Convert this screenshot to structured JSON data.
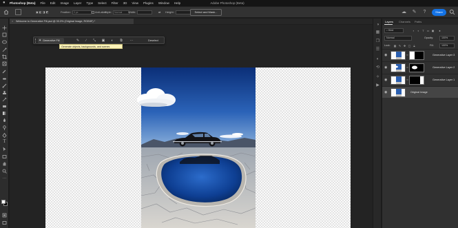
{
  "menubar": {
    "items": [
      "Photoshop (Beta)",
      "File",
      "Edit",
      "Image",
      "Layer",
      "Type",
      "Select",
      "Filter",
      "3D",
      "View",
      "Plugins",
      "Window",
      "Help"
    ],
    "title": "Adobe Photoshop (Beta)"
  },
  "options": {
    "feather_label": "Feather:",
    "feather_value": "0 px",
    "style_label": "Style:",
    "style_value": "Normal",
    "width_label": "Width:",
    "height_label": "Height:",
    "select_mask": "Select and Mask...",
    "share": "Share"
  },
  "document": {
    "tab_title": "Welcome to Generative Fill.psd @ 33.3% (Original Image, RGB/8*) *",
    "close_glyph": "×"
  },
  "taskbar": {
    "generative_fill": "Generative Fill",
    "deselect": "Deselect",
    "more": "···",
    "tooltip": "Generate objects, backgrounds, and scenes"
  },
  "layers_panel": {
    "tabs": [
      "Layers",
      "Channels",
      "Paths"
    ],
    "kind_label": "Kind",
    "blend_mode": "Normal",
    "opacity_label": "Opacity:",
    "opacity_value": "100%",
    "lock_label": "Lock:",
    "fill_label": "Fill:",
    "fill_value": "100%",
    "layers": [
      {
        "name": "Generative Layer 3",
        "visible": true,
        "selected": false
      },
      {
        "name": "Generative Layer 2",
        "visible": true,
        "selected": false
      },
      {
        "name": "Generative Layer 1",
        "visible": true,
        "selected": false
      },
      {
        "name": "Original Image",
        "visible": true,
        "selected": true
      }
    ]
  },
  "colors": {
    "accent": "#1473e6",
    "app_bg": "#1e1e1e",
    "panel_bg": "#303030",
    "tooltip_bg": "#fff4b8"
  }
}
